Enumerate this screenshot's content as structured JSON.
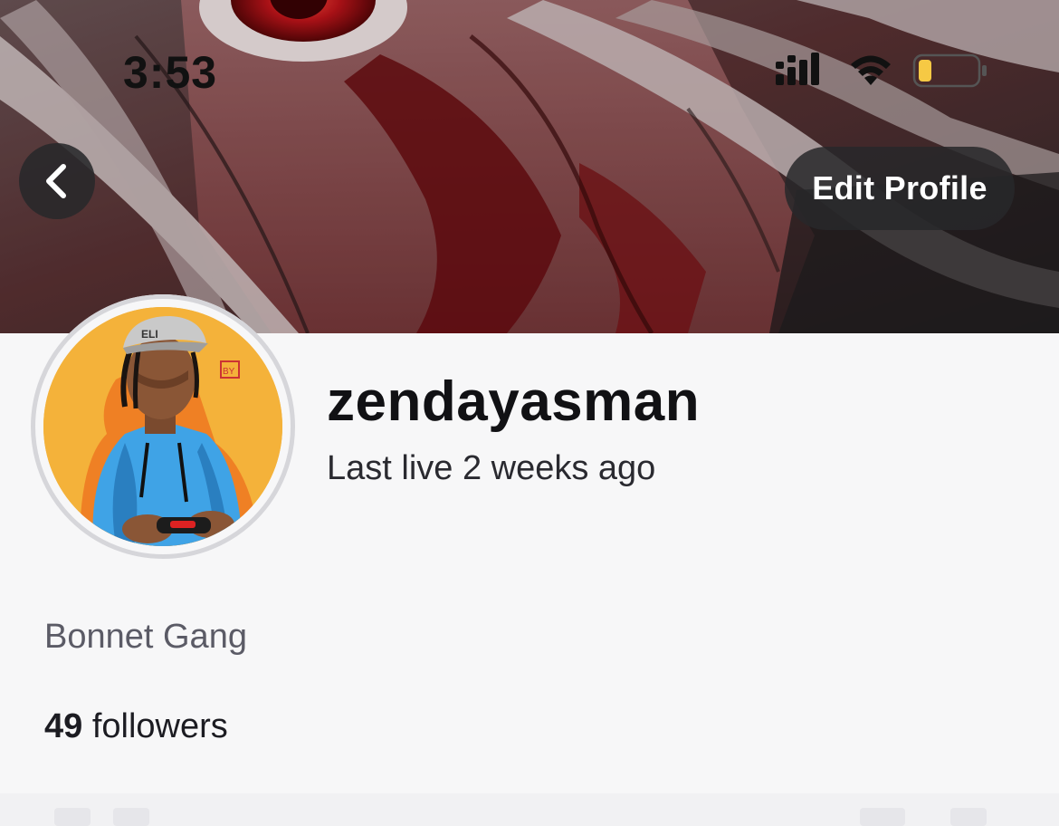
{
  "status_bar": {
    "time": "3:53",
    "battery_color": "#f6c944"
  },
  "nav": {
    "back_icon": "chevron-left-icon",
    "edit_profile_label": "Edit Profile"
  },
  "profile": {
    "username": "zendayasman",
    "last_live": "Last live 2 weeks ago",
    "bio": "Bonnet Gang",
    "followers_count": "49",
    "followers_label": "followers"
  },
  "theme": {
    "page_background": "#f7f7f8",
    "banner_tint": "#8a2a2a",
    "avatar_background": "#f4b23a",
    "button_background": "#28282a"
  }
}
